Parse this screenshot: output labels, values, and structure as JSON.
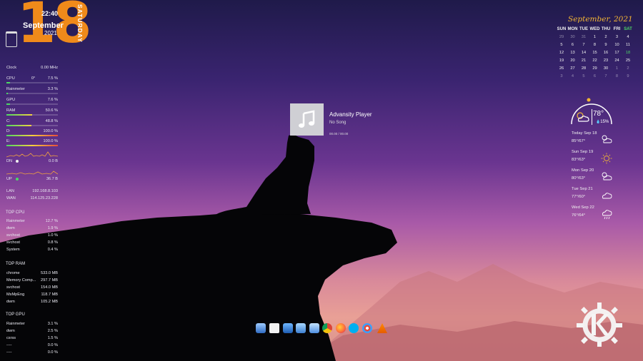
{
  "clock": {
    "day_number": "18",
    "time": "22:40",
    "month": "September",
    "year": "2021",
    "weekday": "SATURDAY"
  },
  "system": {
    "clock": {
      "label": "Clock",
      "value": "0.00 MHz"
    },
    "cpu": {
      "label": "CPU",
      "temp": "0°",
      "value": "7.5 %",
      "fill": 0.075
    },
    "rainmeter": {
      "label": "Rainmeter",
      "value": "3.3 %",
      "fill": 0.033
    },
    "gpu": {
      "label": "GPU",
      "value": "7.6 %",
      "fill": 0.076
    },
    "ram": {
      "label": "RAM",
      "value": "50.6 %",
      "fill": 0.506
    },
    "disk_c": {
      "label": "C:",
      "value": "48.8 %",
      "fill": 0.488
    },
    "disk_d": {
      "label": "D:",
      "value": "100.0 %",
      "fill": 1.0
    },
    "disk_e": {
      "label": "E:",
      "value": "100.0 %",
      "fill": 1.0
    },
    "down": {
      "label": "DN",
      "value": "0.0 B"
    },
    "up": {
      "label": "UP",
      "value": "36.7 B"
    },
    "lan": {
      "label": "LAN",
      "value": "192.168.8.103"
    },
    "wan": {
      "label": "WAN",
      "value": "114.125.23.228"
    }
  },
  "top_cpu": {
    "title": "TOP CPU",
    "items": [
      {
        "name": "Rainmeter",
        "value": "12.7 %"
      },
      {
        "name": "dwm",
        "value": "1.9 %"
      },
      {
        "name": "svchost",
        "value": "1.0 %"
      },
      {
        "name": "svchost",
        "value": "0.8 %"
      },
      {
        "name": "System",
        "value": "0.4 %"
      }
    ]
  },
  "top_ram": {
    "title": "TOP RAM",
    "items": [
      {
        "name": "chrome",
        "value": "533.0 MB"
      },
      {
        "name": "Memory Comp...",
        "value": "297.7 MB"
      },
      {
        "name": "svchost",
        "value": "154.0 MB"
      },
      {
        "name": "MsMpEng",
        "value": "118.7 MB"
      },
      {
        "name": "dwm",
        "value": "105.2 MB"
      }
    ]
  },
  "top_gpu": {
    "title": "TOP GPU",
    "items": [
      {
        "name": "Rainmeter",
        "value": "3.1 %"
      },
      {
        "name": "dwm",
        "value": "2.5 %"
      },
      {
        "name": "csrss",
        "value": "1.5 %"
      },
      {
        "name": "----",
        "value": "0.0 %"
      },
      {
        "name": "----",
        "value": "0.0 %"
      }
    ]
  },
  "player": {
    "title": "Advansity Player",
    "song": "No Song",
    "time": "00.00 / 00.00"
  },
  "calendar": {
    "title": "September, 2021",
    "headers": [
      "SUN",
      "MON",
      "TUE",
      "WED",
      "THU",
      "FRI",
      "SAT"
    ],
    "rows": [
      [
        "29",
        "30",
        "31",
        "1",
        "2",
        "3",
        "4"
      ],
      [
        "5",
        "6",
        "7",
        "8",
        "9",
        "10",
        "11"
      ],
      [
        "12",
        "13",
        "14",
        "15",
        "16",
        "17",
        "18"
      ],
      [
        "19",
        "20",
        "21",
        "22",
        "23",
        "24",
        "25"
      ],
      [
        "26",
        "27",
        "28",
        "29",
        "30",
        "1",
        "2"
      ],
      [
        "3",
        "4",
        "5",
        "6",
        "7",
        "8",
        "9"
      ]
    ],
    "accent": "#4cd964",
    "gold": "#f2b534"
  },
  "weather": {
    "current_temp": "78°",
    "humidity": "15%",
    "forecast": [
      {
        "day": "Today Sep 18",
        "temp": "85°/67°",
        "icon": "partly-cloudy-icon"
      },
      {
        "day": "Sun Sep 19",
        "temp": "83°/63°",
        "icon": "sunny-icon"
      },
      {
        "day": "Mon Sep 20",
        "temp": "80°/63°",
        "icon": "partly-cloudy-icon"
      },
      {
        "day": "Tue Sep 21",
        "temp": "77°/60°",
        "icon": "cloudy-icon"
      },
      {
        "day": "Wed Sep 22",
        "temp": "76°/64°",
        "icon": "rain-cloud-icon"
      }
    ]
  },
  "dock": {
    "icons": [
      "this-pc-icon",
      "documents-icon",
      "desktop-icon",
      "network-icon",
      "user-folder-icon",
      "chrome-icon",
      "firefox-icon",
      "skype-icon",
      "paint-icon",
      "vlc-icon"
    ]
  },
  "colors": {
    "orange": "#f08a1a",
    "background_top": "#1f1a4a",
    "background_bottom": "#d79088"
  }
}
